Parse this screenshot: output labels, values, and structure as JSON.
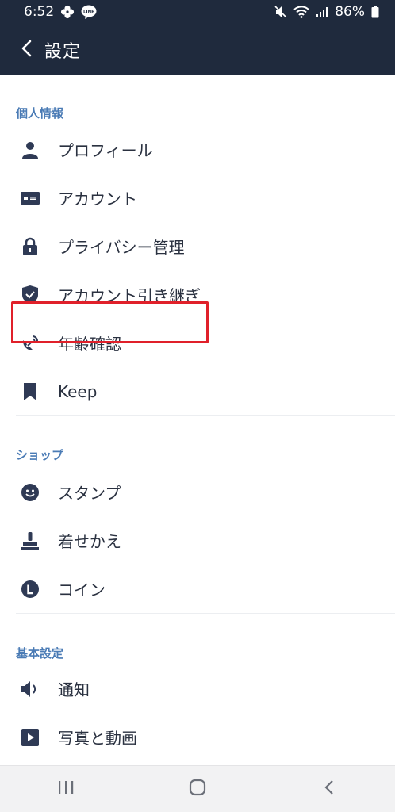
{
  "status_bar": {
    "time": "6:52",
    "battery": "86%",
    "left_icons": [
      "pinwheel-icon",
      "line-notification-icon"
    ],
    "right_icons": [
      "mute-icon",
      "wifi-icon",
      "signal-icon",
      "battery-icon"
    ]
  },
  "header": {
    "title": "設定",
    "back_icon": "chevron-left-icon"
  },
  "sections": [
    {
      "title": "個人情報",
      "items": [
        {
          "label": "プロフィール",
          "icon": "person-icon"
        },
        {
          "label": "アカウント",
          "icon": "id-card-icon"
        },
        {
          "label": "プライバシー管理",
          "icon": "lock-icon",
          "highlighted": true
        },
        {
          "label": "アカウント引き継ぎ",
          "icon": "shield-icon"
        },
        {
          "label": "年齢確認",
          "icon": "satellite-icon"
        },
        {
          "label": "Keep",
          "icon": "bookmark-icon"
        }
      ]
    },
    {
      "title": "ショップ",
      "items": [
        {
          "label": "スタンプ",
          "icon": "smiley-icon"
        },
        {
          "label": "着せかえ",
          "icon": "stamp-icon"
        },
        {
          "label": "コイン",
          "icon": "coin-icon"
        }
      ]
    },
    {
      "title": "基本設定",
      "items": [
        {
          "label": "通知",
          "icon": "speaker-icon"
        },
        {
          "label": "写真と動画",
          "icon": "play-icon"
        }
      ]
    }
  ],
  "colors": {
    "header_bg": "#1f2a3d",
    "section_title": "#4a7bb5",
    "icon": "#2f3a55",
    "highlight_border": "#e0202a",
    "navbar_bg": "#f2f2f3"
  },
  "navbar": {
    "buttons": [
      "recent-apps-icon",
      "home-icon",
      "back-icon"
    ]
  }
}
